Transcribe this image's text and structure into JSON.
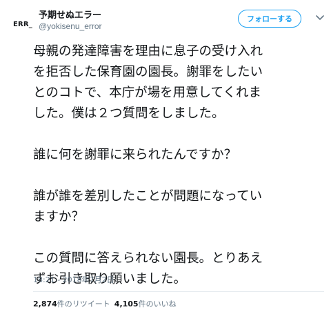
{
  "user": {
    "avatar_text": "ERR_",
    "display_name": "予期せぬエラー",
    "handle": "@yokisenu_error"
  },
  "follow_label": "フォローする",
  "caret_icon": "chevron-down-icon",
  "colors": {
    "accent": "#1da1f2",
    "text": "#14171a",
    "muted": "#657786"
  },
  "tweet": {
    "lines": [
      "母親の発達障害を理由に息子の受け入れ",
      "を拒否した保育園の園長。謝罪をしたい",
      "とのコトで、本庁が場を用意してくれま",
      "した。僕は２つ質問をしました。",
      "",
      "誰に何を謝罪に来られたんですか？",
      "",
      "誰が誰を差別したことが問題になってい",
      "ますか？",
      "",
      "この質問に答えられない園長。とりあえ",
      "ずお引き取り願いました。"
    ]
  },
  "timestamp": "18:21 - 2018年7月2日",
  "stats": {
    "retweets_count": "2,874",
    "retweets_label": "件のリツイート",
    "likes_count": "4,105",
    "likes_label": "件のいいね"
  }
}
